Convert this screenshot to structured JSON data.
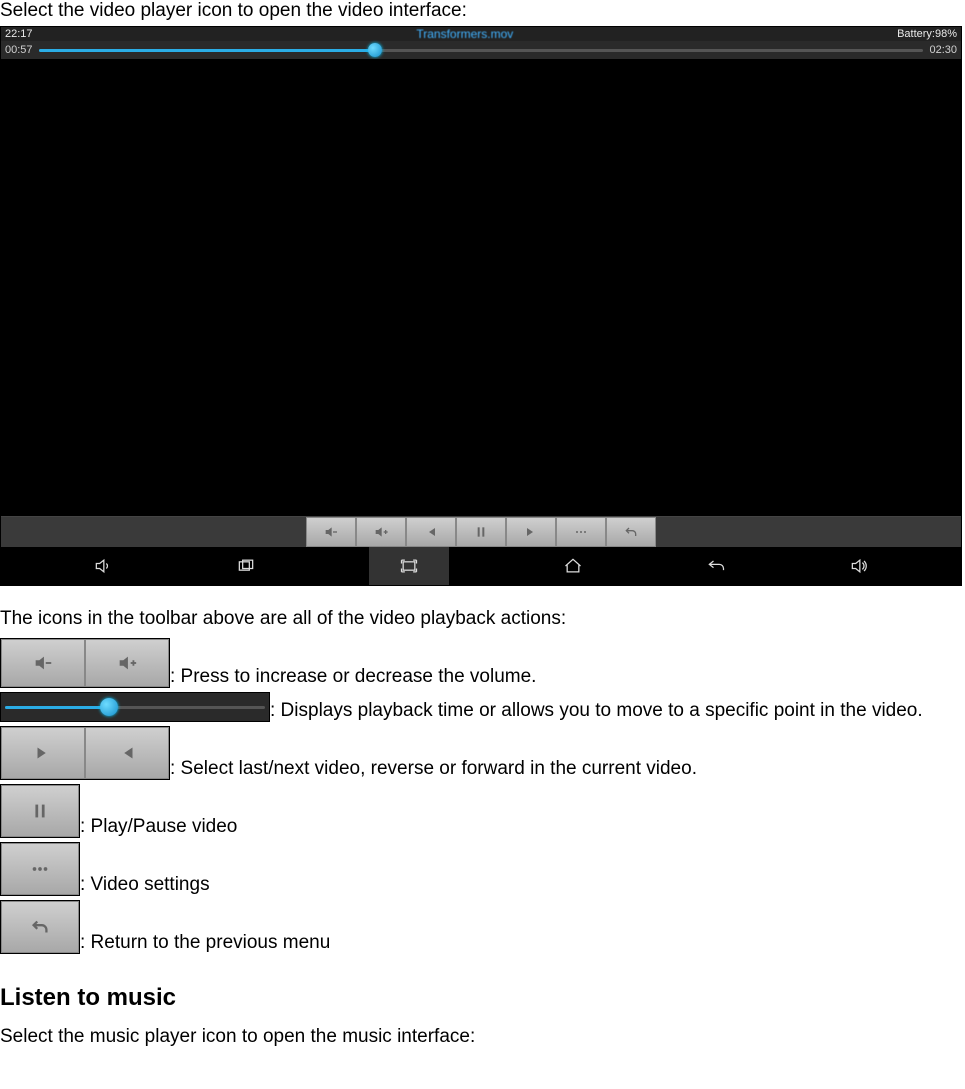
{
  "intro": "Select the video player icon to open the video interface:",
  "player": {
    "clock": "22:17",
    "filename": "Transformers.mov",
    "battery": "Battery:98%",
    "time_current": "00:57",
    "time_total": "02:30",
    "progress_pct": 38
  },
  "legend_intro": "The icons in the toolbar above are all of the video playback actions:",
  "legend": {
    "volume": ": Press to increase or decrease the volume.",
    "seek": ": Displays playback time or allows you to move to a specific point in the video.",
    "skip": ": Select last/next video, reverse or forward in the current video.",
    "pause": ": Play/Pause video",
    "settings": ": Video settings",
    "back": ": Return to the previous menu"
  },
  "section_heading": "Listen to music",
  "section_text": "Select the music player icon to open the music interface:"
}
